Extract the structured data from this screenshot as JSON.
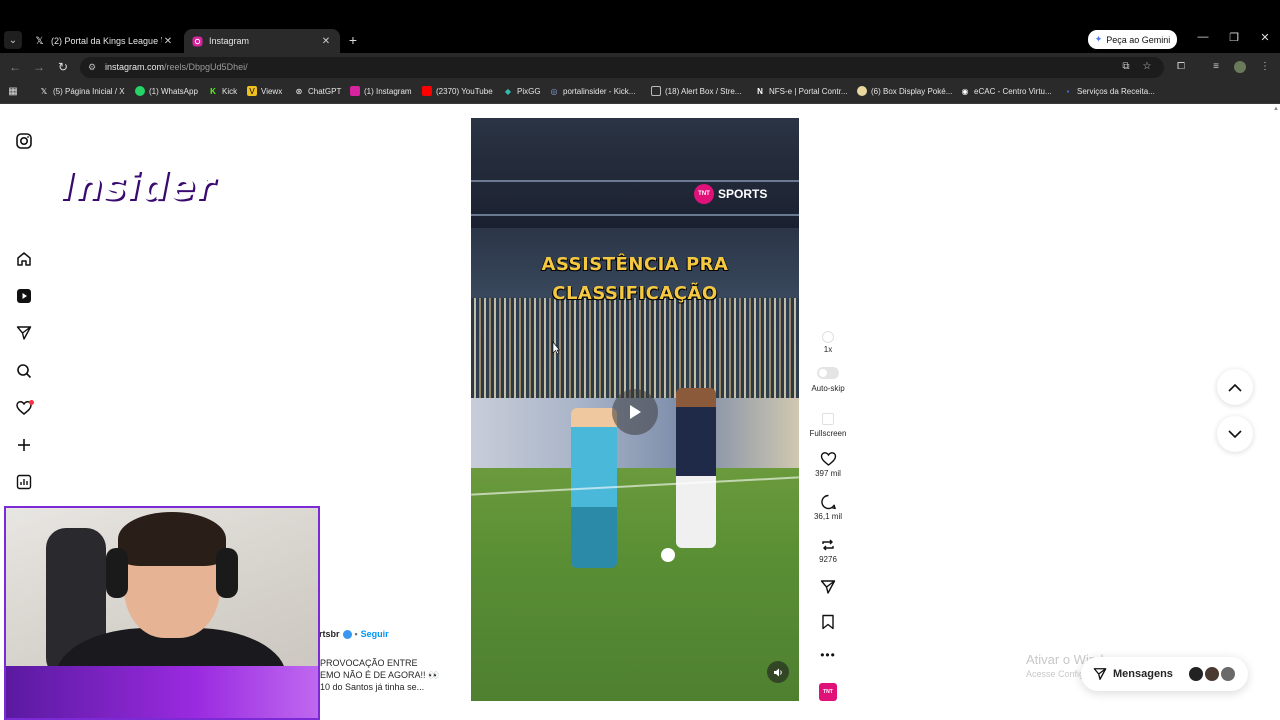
{
  "browser": {
    "tabs": [
      {
        "label": "(2) Portal da Kings League 👑 (",
        "favicon": "x-icon",
        "active": false
      },
      {
        "label": "Instagram",
        "favicon": "instagram-icon",
        "active": true
      }
    ],
    "gemini_button": "Peça ao Gemini",
    "url": {
      "host": "instagram.com",
      "path": "/reels/DbpgUd5Dhei/"
    },
    "bookmarks": [
      {
        "label": "(5) Página Inicial / X",
        "icon": "x-icon"
      },
      {
        "label": "(1) WhatsApp",
        "icon": "whatsapp-icon"
      },
      {
        "label": "Kick",
        "icon": "kick-icon"
      },
      {
        "label": "Viewx",
        "icon": "viewx-icon"
      },
      {
        "label": "ChatGPT",
        "icon": "chatgpt-icon"
      },
      {
        "label": "(1) Instagram",
        "icon": "instagram-icon"
      },
      {
        "label": "(2370) YouTube",
        "icon": "youtube-icon"
      },
      {
        "label": "PixGG",
        "icon": "pixgg-icon"
      },
      {
        "label": "portalinsider - Kick...",
        "icon": "discord-icon"
      },
      {
        "label": "(18) Alert Box / Stre...",
        "icon": "alertbox-icon"
      },
      {
        "label": "NFS-e | Portal Contr...",
        "icon": "nfse-icon"
      },
      {
        "label": "(6) Box Display Poké...",
        "icon": "pokemon-icon"
      },
      {
        "label": "eCAC - Centro Virtu...",
        "icon": "ecac-icon"
      },
      {
        "label": "Serviços da Receita...",
        "icon": "receita-icon"
      }
    ]
  },
  "reel": {
    "channel_logo": "TNT",
    "channel_name": "SPORTS",
    "headline_line1": "ASSISTÊNCIA PRA",
    "headline_line2": "CLASSIFICAÇÃO",
    "actions": {
      "speed_label": "1x",
      "autoskip_label": "Auto-skip",
      "fullscreen_label": "Fullscreen",
      "likes": "397 mil",
      "comments": "36,1 mil",
      "reposts": "9276"
    },
    "audio_thumb": "TNT",
    "caption_user": "rtsbr",
    "follow_label": "Seguir",
    "caption_text": "PROVOCAÇÃO ENTRE\nEMO NÃO É DE AGORA!! 👀\n10 do Santos já tinha se..."
  },
  "webcam": {
    "overlay_text": "Insider"
  },
  "windows_watermark": {
    "line1": "Ativar o Windows",
    "line2": "Acesse Configurações para ativar o Windows."
  },
  "messages_label": "Mensagens"
}
